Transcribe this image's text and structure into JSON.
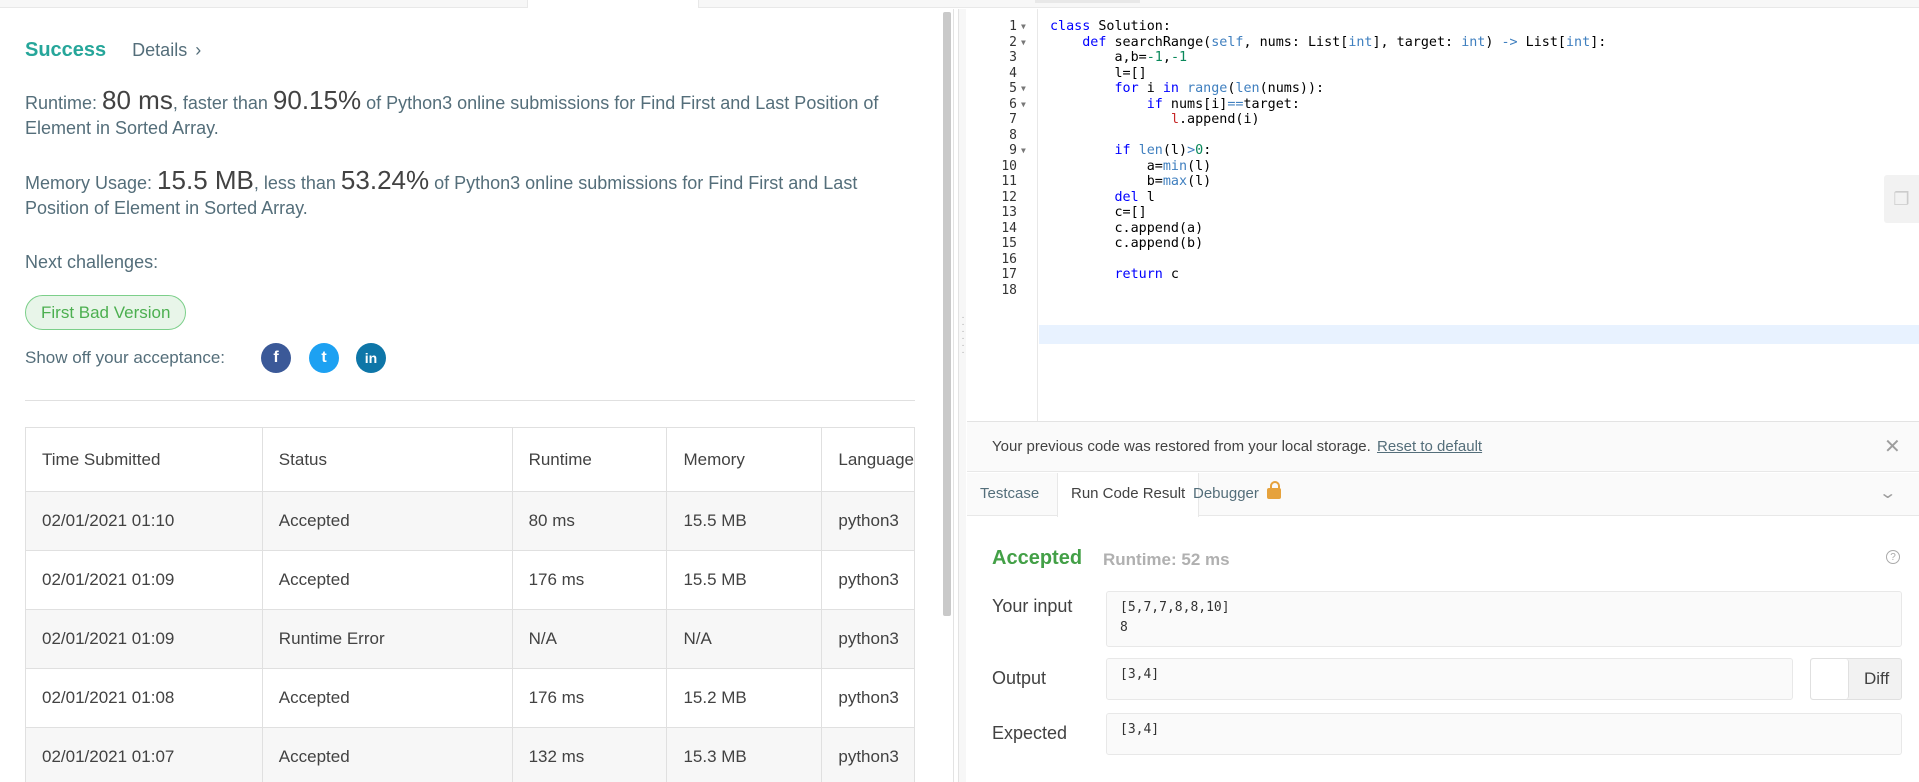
{
  "result": {
    "status": "Success",
    "details_label": "Details",
    "runtime_prefix": "Runtime: ",
    "runtime_value": "80 ms",
    "runtime_mid": ", faster than ",
    "runtime_percent": "90.15%",
    "runtime_suffix": " of Python3 online submissions for Find First and Last Position of Element in Sorted Array.",
    "memory_prefix": "Memory Usage: ",
    "memory_value": "15.5 MB",
    "memory_mid": ", less than ",
    "memory_percent": "53.24%",
    "memory_suffix": " of Python3 online submissions for Find First and Last Position of Element in Sorted Array.",
    "next_challenges": "Next challenges:",
    "next_chip": "First Bad Version",
    "show_off": "Show off your acceptance:"
  },
  "social": {
    "facebook": "f",
    "twitter": "t",
    "linkedin": "in"
  },
  "submissions": {
    "headers": [
      "Time Submitted",
      "Status",
      "Runtime",
      "Memory",
      "Language"
    ],
    "rows": [
      [
        "02/01/2021 01:10",
        "Accepted",
        "80 ms",
        "15.5 MB",
        "python3"
      ],
      [
        "02/01/2021 01:09",
        "Accepted",
        "176 ms",
        "15.5 MB",
        "python3"
      ],
      [
        "02/01/2021 01:09",
        "Runtime Error",
        "N/A",
        "N/A",
        "python3"
      ],
      [
        "02/01/2021 01:08",
        "Accepted",
        "176 ms",
        "15.2 MB",
        "python3"
      ],
      [
        "02/01/2021 01:07",
        "Accepted",
        "132 ms",
        "15.3 MB",
        "python3"
      ]
    ]
  },
  "editor": {
    "line_numbers": [
      "1",
      "2",
      "3",
      "4",
      "5",
      "6",
      "7",
      "8",
      "9",
      "10",
      "11",
      "12",
      "13",
      "14",
      "15",
      "16",
      "17",
      "18"
    ],
    "lines": [
      "class Solution:",
      "    def searchRange(self, nums: List[int], target: int) -> List[int]:",
      "        a,b=-1,-1",
      "        l=[]",
      "        for i in range(len(nums)):",
      "            if nums[i]==target:",
      "               l.append(i)",
      "",
      "        if len(l)>0:",
      "            a=min(l)",
      "            b=max(l)",
      "        del l",
      "        c=[]",
      "        c.append(a)",
      "        c.append(b)",
      "",
      "        return c",
      ""
    ]
  },
  "console": {
    "notice": "Your previous code was restored from your local storage.",
    "reset_link": "Reset to default",
    "tabs": [
      "Testcase",
      "Run Code Result",
      "Debugger"
    ],
    "status": "Accepted",
    "runtime": "Runtime: 52 ms",
    "input_label": "Your input",
    "input_value": "[5,7,7,8,8,10]\n8",
    "output_label": "Output",
    "output_value": "[3,4]",
    "expected_label": "Expected",
    "expected_value": "[3,4]",
    "diff_label": "Diff"
  }
}
